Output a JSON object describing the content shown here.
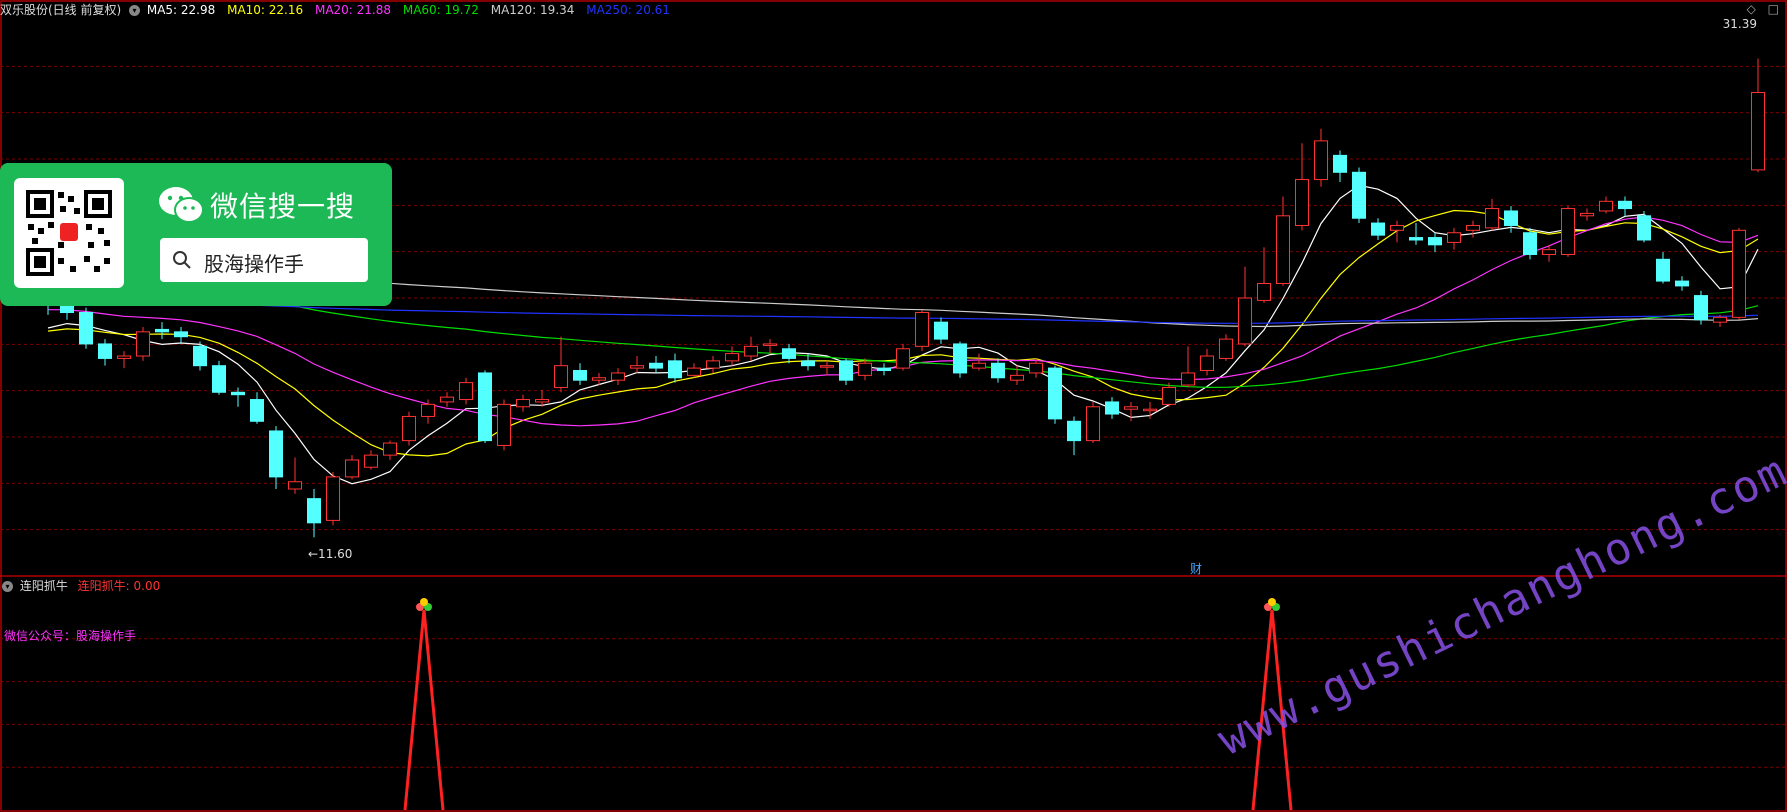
{
  "header": {
    "stock_title": "双乐股份(日线 前复权)",
    "settings_icon": "gear-circle-icon",
    "ma": [
      {
        "label": "MA5: 22.98",
        "color": "#ffffff"
      },
      {
        "label": "MA10: 22.16",
        "color": "#ffff00"
      },
      {
        "label": "MA20: 21.88",
        "color": "#ff33ff"
      },
      {
        "label": "MA60: 19.72",
        "color": "#00dd00"
      },
      {
        "label": "MA120: 19.34",
        "color": "#cccccc"
      },
      {
        "label": "MA250: 20.61",
        "color": "#2233ff"
      }
    ]
  },
  "labels": {
    "high_price": "31.39",
    "low_price": "←11.60",
    "finance_marker": "财",
    "window_icons": "◇ □"
  },
  "indicator": {
    "name": "连阳抓牛",
    "value_label": "连阳抓牛: 0.00",
    "name_color": "#dddddd",
    "value_color": "#ff3333",
    "public_account": "微信公众号：股海操作手"
  },
  "promo": {
    "title": "微信搜一搜",
    "search_text": "股海操作手",
    "logo_icon": "wechat-icon",
    "qr_icon": "qr-code-icon",
    "search_icon": "search-icon"
  },
  "watermark": "www.gushichanghong.com",
  "colors": {
    "up": "#ff3333",
    "down": "#54ffff",
    "grid": "#7a0000",
    "border": "#b00000",
    "ma5": "#ffffff",
    "ma10": "#ffff00",
    "ma20": "#ff33ff",
    "ma60": "#00dd00",
    "ma120": "#cccccc",
    "ma250": "#2233ff",
    "signal": "#ff2222"
  },
  "chart_data": [
    {
      "type": "candlestick",
      "title": "双乐股份(日线 前复权)",
      "ylim": [
        10.0,
        33.0
      ],
      "candles": [
        [
          21.5,
          21.3,
          21.8,
          20.8
        ],
        [
          21.3,
          20.9,
          21.6,
          20.6
        ],
        [
          20.9,
          19.6,
          21.1,
          19.4
        ],
        [
          19.6,
          19.0,
          19.8,
          18.7
        ],
        [
          19.0,
          19.1,
          19.3,
          18.6
        ],
        [
          19.1,
          20.1,
          20.3,
          18.9
        ],
        [
          20.2,
          20.1,
          20.5,
          19.8
        ],
        [
          20.1,
          19.9,
          20.3,
          19.6
        ],
        [
          19.5,
          18.7,
          19.7,
          18.5
        ],
        [
          18.7,
          17.6,
          18.9,
          17.5
        ],
        [
          17.6,
          17.5,
          17.8,
          17.0
        ],
        [
          17.3,
          16.4,
          17.6,
          16.3
        ],
        [
          16.0,
          14.1,
          16.2,
          13.6
        ],
        [
          13.6,
          13.9,
          14.9,
          13.4
        ],
        [
          13.2,
          12.2,
          13.6,
          11.6
        ],
        [
          12.3,
          14.1,
          14.3,
          12.1
        ],
        [
          14.1,
          14.8,
          15.0,
          14.0
        ],
        [
          14.5,
          15.0,
          15.2,
          14.4
        ],
        [
          15.0,
          15.5,
          15.6,
          14.8
        ],
        [
          15.6,
          16.6,
          16.8,
          15.4
        ],
        [
          16.6,
          17.1,
          17.3,
          16.3
        ],
        [
          17.2,
          17.4,
          17.6,
          17.0
        ],
        [
          17.3,
          18.0,
          18.2,
          17.1
        ],
        [
          18.4,
          15.6,
          18.5,
          15.5
        ],
        [
          15.4,
          17.1,
          17.3,
          15.2
        ],
        [
          17.0,
          17.3,
          17.5,
          16.8
        ],
        [
          17.2,
          17.3,
          17.7,
          17.0
        ],
        [
          17.8,
          18.7,
          19.9,
          17.6
        ],
        [
          18.5,
          18.1,
          18.8,
          17.9
        ],
        [
          18.1,
          18.2,
          18.4,
          17.9
        ],
        [
          18.1,
          18.4,
          18.6,
          17.9
        ],
        [
          18.6,
          18.7,
          19.1,
          18.4
        ],
        [
          18.8,
          18.6,
          19.1,
          18.4
        ],
        [
          18.9,
          18.2,
          19.2,
          18.0
        ],
        [
          18.3,
          18.6,
          18.8,
          18.2
        ],
        [
          18.6,
          18.9,
          19.1,
          18.4
        ],
        [
          18.9,
          19.2,
          19.5,
          18.7
        ],
        [
          19.1,
          19.5,
          19.9,
          18.9
        ],
        [
          19.6,
          19.6,
          19.8,
          19.2
        ],
        [
          19.4,
          19.0,
          19.6,
          18.8
        ],
        [
          18.9,
          18.7,
          19.2,
          18.5
        ],
        [
          18.7,
          18.7,
          18.9,
          18.3
        ],
        [
          18.9,
          18.1,
          19.0,
          17.9
        ],
        [
          18.3,
          18.8,
          19.0,
          18.1
        ],
        [
          18.6,
          18.5,
          18.8,
          18.3
        ],
        [
          18.6,
          19.4,
          19.6,
          18.5
        ],
        [
          19.5,
          20.9,
          21.0,
          19.3
        ],
        [
          20.5,
          19.8,
          20.7,
          19.6
        ],
        [
          19.6,
          18.4,
          19.7,
          18.2
        ],
        [
          18.6,
          18.8,
          19.2,
          18.5
        ],
        [
          18.8,
          18.2,
          19.0,
          18.0
        ],
        [
          18.1,
          18.3,
          18.7,
          17.9
        ],
        [
          18.4,
          18.8,
          19.0,
          18.2
        ],
        [
          18.6,
          16.5,
          18.7,
          16.3
        ],
        [
          16.4,
          15.6,
          16.6,
          15.0
        ],
        [
          15.6,
          17.0,
          17.2,
          15.5
        ],
        [
          17.2,
          16.7,
          17.4,
          16.5
        ],
        [
          16.9,
          17.0,
          17.2,
          16.4
        ],
        [
          16.9,
          16.9,
          17.2,
          16.5
        ],
        [
          17.1,
          17.8,
          18.0,
          17.0
        ],
        [
          17.9,
          18.4,
          19.5,
          17.8
        ],
        [
          18.5,
          19.1,
          19.4,
          18.3
        ],
        [
          19.0,
          19.8,
          20.0,
          18.9
        ],
        [
          19.6,
          21.5,
          22.8,
          19.5
        ],
        [
          21.4,
          22.1,
          23.6,
          21.3
        ],
        [
          22.1,
          24.9,
          25.7,
          22.0
        ],
        [
          24.5,
          26.4,
          27.9,
          24.3
        ],
        [
          26.4,
          28.0,
          28.5,
          26.1
        ],
        [
          27.4,
          26.7,
          27.6,
          26.3
        ],
        [
          26.7,
          24.8,
          26.9,
          24.6
        ],
        [
          24.6,
          24.1,
          24.8,
          23.9
        ],
        [
          24.3,
          24.5,
          24.7,
          23.8
        ],
        [
          24.0,
          23.9,
          24.6,
          23.7
        ],
        [
          24.0,
          23.7,
          24.2,
          23.4
        ],
        [
          23.8,
          24.2,
          24.4,
          23.5
        ],
        [
          24.3,
          24.5,
          24.7,
          24.0
        ],
        [
          24.4,
          25.2,
          25.6,
          24.3
        ],
        [
          25.1,
          24.5,
          25.3,
          24.2
        ],
        [
          24.2,
          23.3,
          24.4,
          23.1
        ],
        [
          23.3,
          23.5,
          23.7,
          23.0
        ],
        [
          23.3,
          25.2,
          25.3,
          23.2
        ],
        [
          24.9,
          25.0,
          25.2,
          24.7
        ],
        [
          25.1,
          25.5,
          25.7,
          25.0
        ],
        [
          25.5,
          25.2,
          25.7,
          24.9
        ],
        [
          24.9,
          23.9,
          25.1,
          23.8
        ],
        [
          23.1,
          22.2,
          23.4,
          22.1
        ],
        [
          22.2,
          22.0,
          22.4,
          21.8
        ],
        [
          21.6,
          20.6,
          21.8,
          20.4
        ],
        [
          20.5,
          20.7,
          20.8,
          20.3
        ],
        [
          20.7,
          24.3,
          24.4,
          20.6
        ],
        [
          26.8,
          30.0,
          31.4,
          26.7
        ]
      ]
    },
    {
      "type": "line",
      "title": "连阳抓牛",
      "signal_indices": [
        21,
        66
      ],
      "value": 0.0
    }
  ]
}
